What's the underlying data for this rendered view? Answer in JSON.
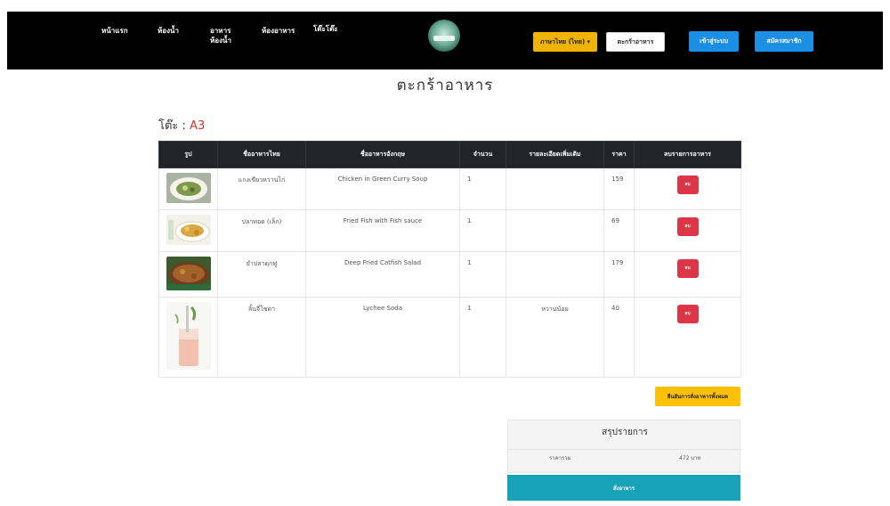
{
  "nav": {
    "links": [
      "หน้าแรก",
      "ห้องน้ำ",
      "อาหาร ห้องน้ำ",
      "ห้องอาหาร",
      "โต๊ะโต๊ะ"
    ],
    "lang_button": "ภาษาไทย (ไทย) ▾",
    "cart_button": "ตะกร้าอาหาร",
    "login_button": "เข้าสู่ระบบ",
    "register_button": "สมัครสมาชิก"
  },
  "page_title": "ตะกร้าอาหาร",
  "table_label": "โต๊ะ :",
  "table_number": "A3",
  "table": {
    "headers": [
      "รูป",
      "ชื่ออาหารไทย",
      "ชื่ออาหารอังกฤษ",
      "จำนวน",
      "รายละเอียดเพิ่มเติม",
      "ราคา",
      "ลบรายการอาหาร"
    ],
    "rows": [
      {
        "th_name": "แกงเขียวหวานไก่",
        "en_name": "Chicken in Green Curry Soup",
        "qty": "1",
        "note": "",
        "price": "159",
        "delete": "ลบ"
      },
      {
        "th_name": "ปลาทอด (เล็ก)",
        "en_name": "Fried Fish with Fish sauce",
        "qty": "1",
        "note": "",
        "price": "69",
        "delete": "ลบ"
      },
      {
        "th_name": "ยำปลาดุกฟู",
        "en_name": "Deep Fried Catfish Salad",
        "qty": "1",
        "note": "",
        "price": "179",
        "delete": "ลบ"
      },
      {
        "th_name": "ลิ้นจี่โซดา",
        "en_name": "Lychee Soda",
        "qty": "1",
        "note": "หวานน้อย",
        "price": "40",
        "delete": "ลบ"
      }
    ]
  },
  "clear_button": "ยืนยันการสั่งอาหารทั้งหมด",
  "summary": {
    "title": "สรุปรายการ",
    "label": "ราคารวม",
    "value": "472 บาท",
    "order_button": "สั่งอาหาร"
  },
  "colors": {
    "navbar": "#000000",
    "lang_button": "#f0b400",
    "blue_button": "#1a8fe3",
    "delete_button": "#dc3545",
    "clear_button": "#ffc107",
    "order_button": "#17a2b8",
    "table_header": "#212529"
  }
}
